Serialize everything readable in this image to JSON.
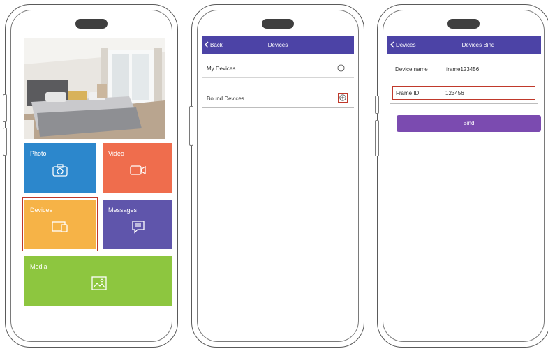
{
  "screen_home": {
    "tiles": [
      {
        "label": "Photo",
        "icon": "camera-icon",
        "color": "#2c87cc"
      },
      {
        "label": "Video",
        "icon": "video-camera-icon",
        "color": "#ef6d4d"
      },
      {
        "label": "Devices",
        "icon": "devices-icon",
        "color": "#f6b347",
        "highlighted": true
      },
      {
        "label": "Messages",
        "icon": "message-icon",
        "color": "#5f55ab"
      },
      {
        "label": "Media",
        "icon": "image-icon",
        "color": "#8dc63f"
      }
    ],
    "highlight_color": "#c0392b"
  },
  "screen_devices": {
    "back_label": "Back",
    "title": "Devices",
    "my_devices_label": "My Devices",
    "bound_devices_label": "Bound Devices",
    "navbar_color": "#4c43a6"
  },
  "screen_bind": {
    "back_label": "Devices",
    "title": "Devices Bind",
    "device_name_label": "Device name",
    "device_name_value": "frame123456",
    "frame_id_label": "Frame ID",
    "frame_id_value": "123456",
    "bind_button_label": "Bind",
    "button_color": "#7b4bb0"
  }
}
